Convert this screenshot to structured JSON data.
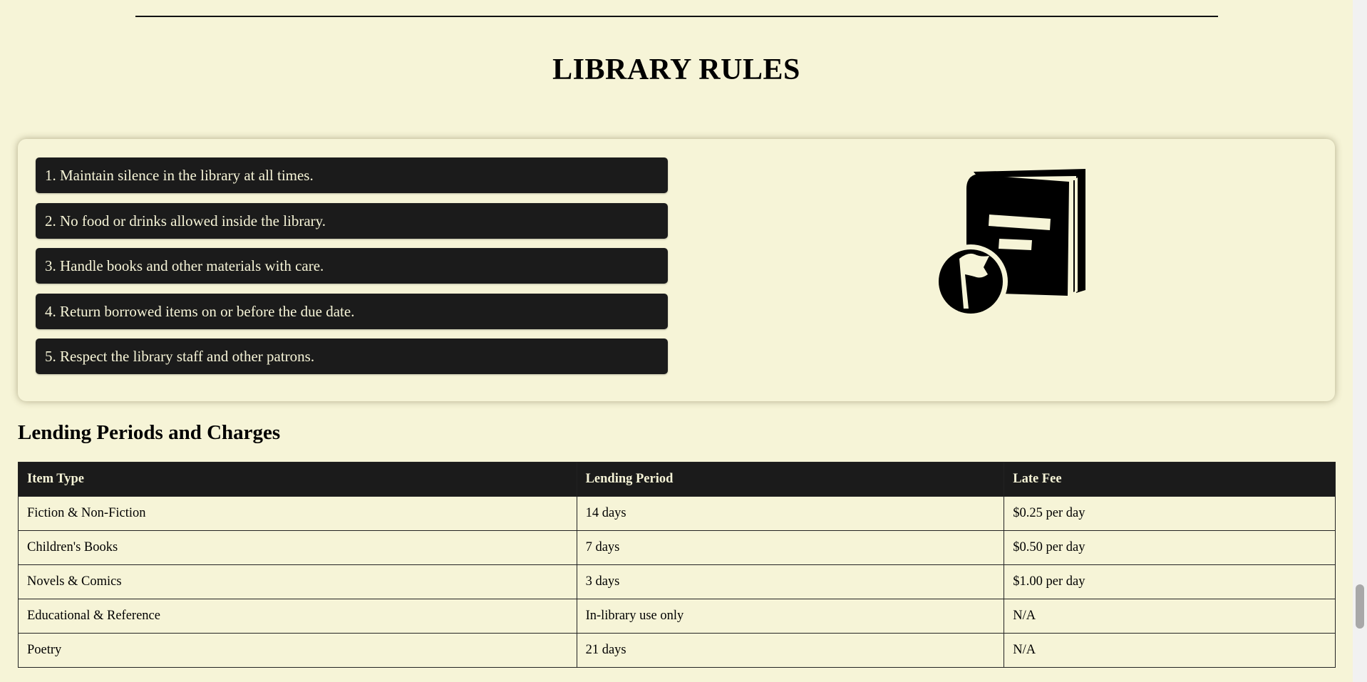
{
  "page": {
    "title": "LIBRARY RULES",
    "rules_graphic_icon": "book-with-flag-icon"
  },
  "rules": [
    "1. Maintain silence in the library at all times.",
    "2. No food or drinks allowed inside the library.",
    "3. Handle books and other materials with care.",
    "4. Return borrowed items on or before the due date.",
    "5. Respect the library staff and other patrons."
  ],
  "lending": {
    "heading": "Lending Periods and Charges",
    "columns": [
      "Item Type",
      "Lending Period",
      "Late Fee"
    ],
    "rows": [
      [
        "Fiction & Non-Fiction",
        "14 days",
        "$0.25 per day"
      ],
      [
        "Children's Books",
        "7 days",
        "$0.50 per day"
      ],
      [
        "Novels & Comics",
        "3 days",
        "$1.00 per day"
      ],
      [
        "Educational & Reference",
        "In-library use only",
        "N/A"
      ],
      [
        "Poetry",
        "21 days",
        "N/A"
      ]
    ]
  },
  "colors": {
    "background": "#f6f4d7",
    "dark": "#1b1b1b",
    "light_text": "#f6f4d7"
  }
}
